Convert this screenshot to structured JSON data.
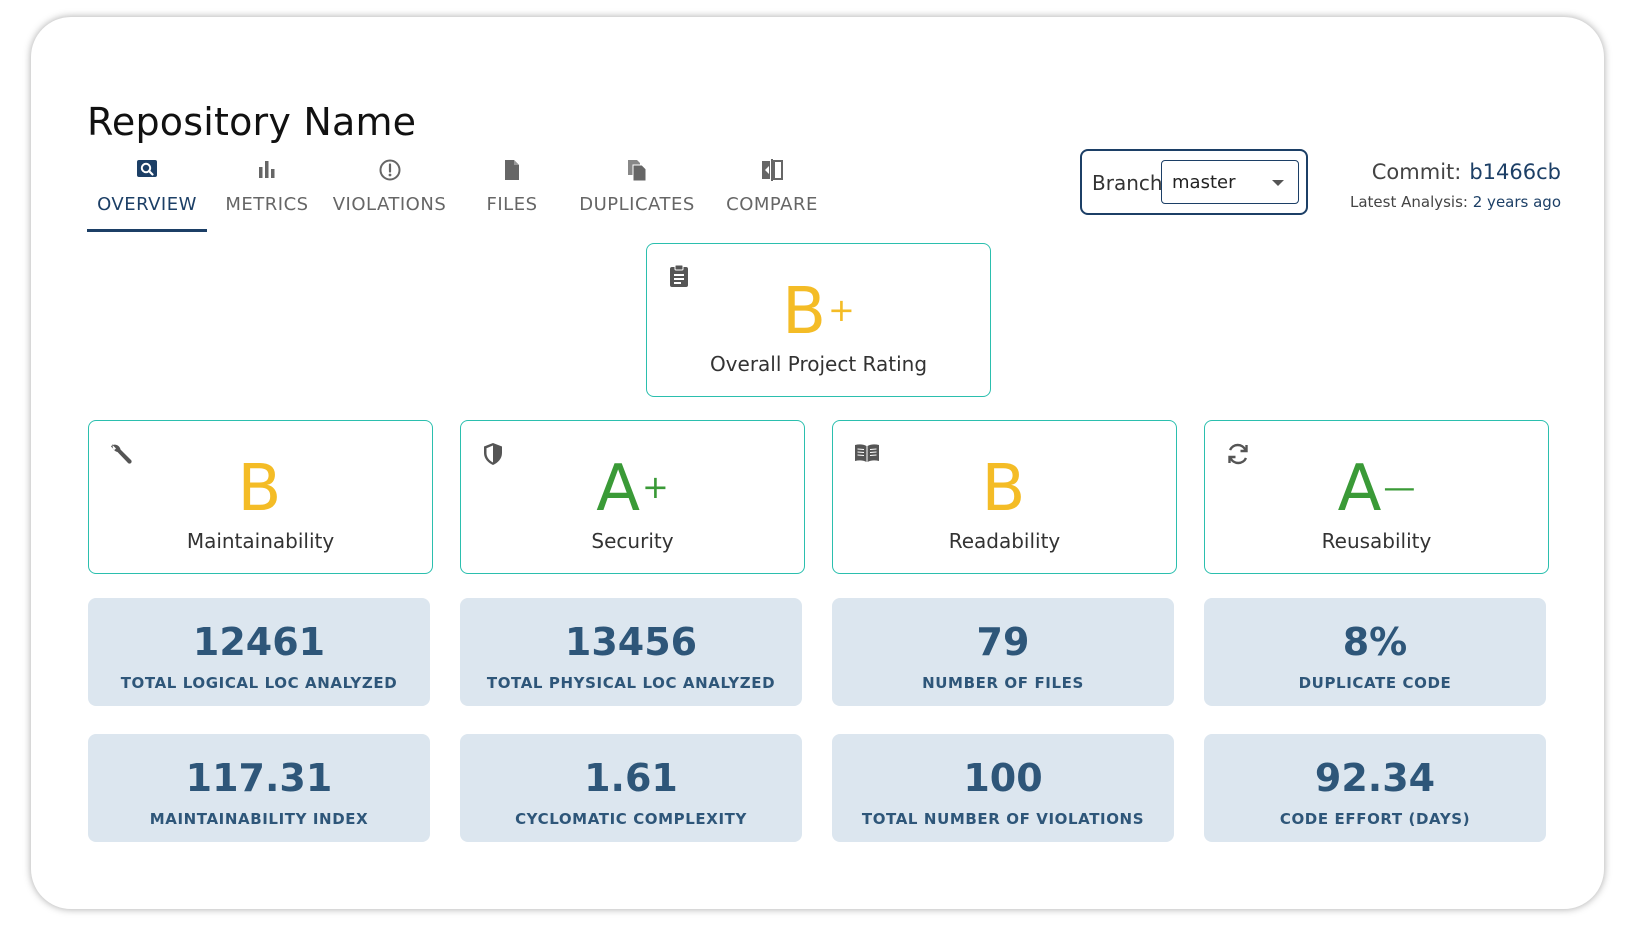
{
  "repo": {
    "title": "Repository Name"
  },
  "tabs": [
    {
      "label": "OVERVIEW",
      "icon": "search-icon",
      "active": true
    },
    {
      "label": "METRICS",
      "icon": "bar-chart-icon"
    },
    {
      "label": "VIOLATIONS",
      "icon": "alert-circle-icon"
    },
    {
      "label": "FILES",
      "icon": "file-icon"
    },
    {
      "label": "DUPLICATES",
      "icon": "copy-icon"
    },
    {
      "label": "COMPARE",
      "icon": "compare-icon"
    }
  ],
  "branch": {
    "label": "Branch",
    "value": "master"
  },
  "commit": {
    "label": "Commit:",
    "hash": "b1466cb",
    "analysis_label": "Latest Analysis:",
    "analysis_value": "2 years ago"
  },
  "overall": {
    "grade": "B",
    "modifier": "+",
    "label": "Overall Project Rating",
    "icon": "clipboard-icon",
    "color": "#f4bc26"
  },
  "ratings": [
    {
      "grade": "B",
      "modifier": "",
      "label": "Maintainability",
      "icon": "wrench-icon",
      "color": "#f4bc26"
    },
    {
      "grade": "A",
      "modifier": "+",
      "label": "Security",
      "icon": "shield-icon",
      "color": "#3a9a37"
    },
    {
      "grade": "B",
      "modifier": "",
      "label": "Readability",
      "icon": "book-icon",
      "color": "#f4bc26"
    },
    {
      "grade": "A",
      "modifier": "—",
      "label": "Reusability",
      "icon": "sync-icon",
      "color": "#3a9a37"
    }
  ],
  "stats": [
    {
      "value": "12461",
      "label": "TOTAL LOGICAL LOC ANALYZED"
    },
    {
      "value": "13456",
      "label": "TOTAL PHYSICAL LOC ANALYZED"
    },
    {
      "value": "79",
      "label": "NUMBER OF FILES"
    },
    {
      "value": "8%",
      "label": "DUPLICATE CODE"
    },
    {
      "value": "117.31",
      "label": "MAINTAINABILITY INDEX"
    },
    {
      "value": "1.61",
      "label": "CYCLOMATIC COMPLEXITY"
    },
    {
      "value": "100",
      "label": "TOTAL NUMBER OF VIOLATIONS"
    },
    {
      "value": "92.34",
      "label": "CODE EFFORT (DAYS)"
    }
  ],
  "colors": {
    "accent": "#1c3f66",
    "card_border": "#2bbfae",
    "stat_bg": "#dce6ef",
    "stat_text": "#2e5679",
    "grade_b": "#f4bc26",
    "grade_a": "#3a9a37"
  }
}
